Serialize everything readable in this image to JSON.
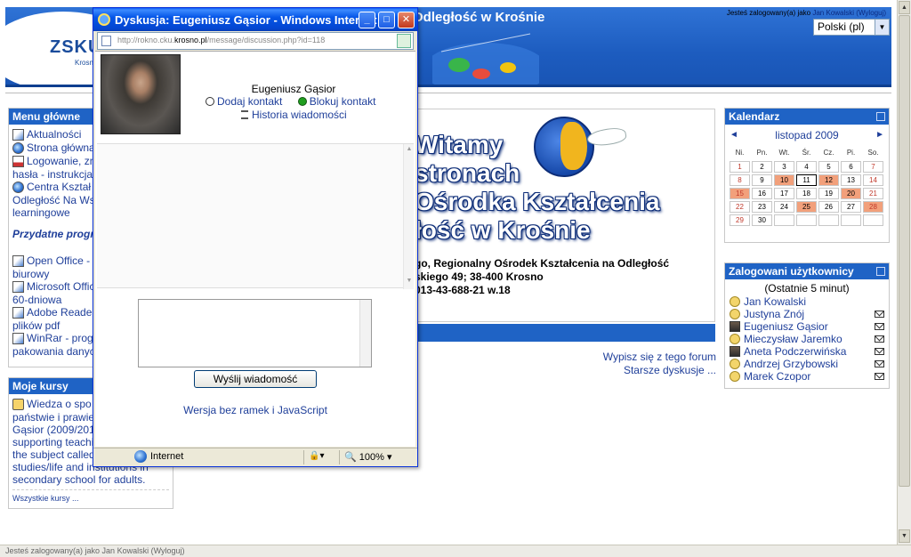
{
  "header": {
    "title": "Odległość w Krośnie",
    "logo_text": "ZSKU",
    "logo_sub": "Krosno",
    "login_prefix": "Jesteś zalogowany(a) jako",
    "login_user": "Jan Kowalski",
    "logout_label": "(Wyloguj)",
    "language": "Polski (pl)"
  },
  "main_menu": {
    "title": "Menu główne",
    "items": [
      {
        "label": "Aktualności",
        "icon": "forum-icon"
      },
      {
        "label": "Strona główna",
        "icon": "globe-icon"
      },
      {
        "label": "Logowanie, zn",
        "label2": "hasła - instrukcja",
        "icon": "pdf-icon"
      },
      {
        "label": "Centra Kształ",
        "label2": "Odległość Na Ws",
        "label3": "learningowe",
        "icon": "globe-icon"
      }
    ],
    "useful_title": "Przydatne progra",
    "useful_items": [
      {
        "label": "Open Office -",
        "label2": "biurowy",
        "icon": "doc-icon"
      },
      {
        "label": "Microsoft Offic",
        "label2": "60-dniowa",
        "icon": "doc-icon"
      },
      {
        "label": "Adobe Reader",
        "label2": "plików pdf",
        "icon": "doc-icon"
      },
      {
        "label": "WinRar - prog",
        "label2": "pakowania danyc",
        "icon": "doc-icon"
      }
    ]
  },
  "my_courses": {
    "title": "Moje kursy",
    "course_lines": [
      "Wiedza o spo",
      "państwie i prawie",
      "Gąsior (2009/201",
      "supporting teachi",
      "the subject called",
      "studies/life and institutions in",
      "secondary school for adults."
    ],
    "all_courses": "Wszystkie kursy ..."
  },
  "center": {
    "welcome_lines": [
      "Witamy",
      "stronach",
      "Ośrodka Kształcenia",
      "łość w Krośnie"
    ],
    "address_lines": [
      "go, Regionalny Ośrodek Kształcenia na Odległość",
      "skiego 49; 38-400 Krosno",
      "013-43-688-21 w.18"
    ],
    "forum_links": [
      "Wypisz się z tego forum",
      "Starsze dyskusje ..."
    ]
  },
  "calendar": {
    "title": "Kalendarz",
    "month": "listopad 2009",
    "prev": "◄",
    "next": "►",
    "weekdays": [
      "Ni.",
      "Pn.",
      "Wt.",
      "Śr.",
      "Cz.",
      "Pi.",
      "So."
    ],
    "days": [
      {
        "d": "1",
        "we": true
      },
      {
        "d": "2"
      },
      {
        "d": "3"
      },
      {
        "d": "4"
      },
      {
        "d": "5"
      },
      {
        "d": "6"
      },
      {
        "d": "7",
        "we": true
      },
      {
        "d": "8",
        "we": true
      },
      {
        "d": "9"
      },
      {
        "d": "10",
        "ev": true
      },
      {
        "d": "11",
        "today": true
      },
      {
        "d": "12",
        "ev": true
      },
      {
        "d": "13"
      },
      {
        "d": "14",
        "we": true
      },
      {
        "d": "15",
        "we": true,
        "ev": true
      },
      {
        "d": "16"
      },
      {
        "d": "17"
      },
      {
        "d": "18"
      },
      {
        "d": "19"
      },
      {
        "d": "20",
        "ev": true
      },
      {
        "d": "21",
        "we": true
      },
      {
        "d": "22",
        "we": true
      },
      {
        "d": "23"
      },
      {
        "d": "24"
      },
      {
        "d": "25",
        "ev": true
      },
      {
        "d": "26"
      },
      {
        "d": "27"
      },
      {
        "d": "28",
        "we": true,
        "ev": true
      },
      {
        "d": "29",
        "we": true
      },
      {
        "d": "30"
      },
      {
        "d": ""
      },
      {
        "d": ""
      },
      {
        "d": ""
      },
      {
        "d": ""
      },
      {
        "d": ""
      }
    ]
  },
  "online_users": {
    "title": "Zalogowani użytkownicy",
    "subtitle": "(Ostatnie 5 minut)",
    "users": [
      {
        "name": "Jan Kowalski",
        "photo": false,
        "msg": false
      },
      {
        "name": "Justyna Znój",
        "photo": false,
        "msg": true
      },
      {
        "name": "Eugeniusz Gąsior",
        "photo": true,
        "msg": true
      },
      {
        "name": "Mieczysław Jaremko",
        "photo": false,
        "msg": true
      },
      {
        "name": "Aneta Podczerwińska",
        "photo": true,
        "msg": true
      },
      {
        "name": "Andrzej Grzybowski",
        "photo": false,
        "msg": true
      },
      {
        "name": "Marek Czopor",
        "photo": false,
        "msg": true
      }
    ]
  },
  "popup": {
    "title": "Dyskusja: Eugeniusz Gąsior - Windows Internet ...",
    "url_prefix": "http://rokno.cku.",
    "url_domain": "krosno.pl",
    "url_path": "/message/discussion.php?id=118",
    "user_name": "Eugeniusz Gąsior",
    "add_contact": "Dodaj kontakt",
    "block_contact": "Blokuj kontakt",
    "history": "Historia wiadomości",
    "message_value": "",
    "send_label": "Wyślij wiadomość",
    "noframes_link": "Wersja bez ramek i JavaScript",
    "status_zone": "Internet",
    "zoom": "100%"
  },
  "statusbar_text": "Jesteś zalogowany(a) jako Jan Kowalski (Wyloguj)"
}
